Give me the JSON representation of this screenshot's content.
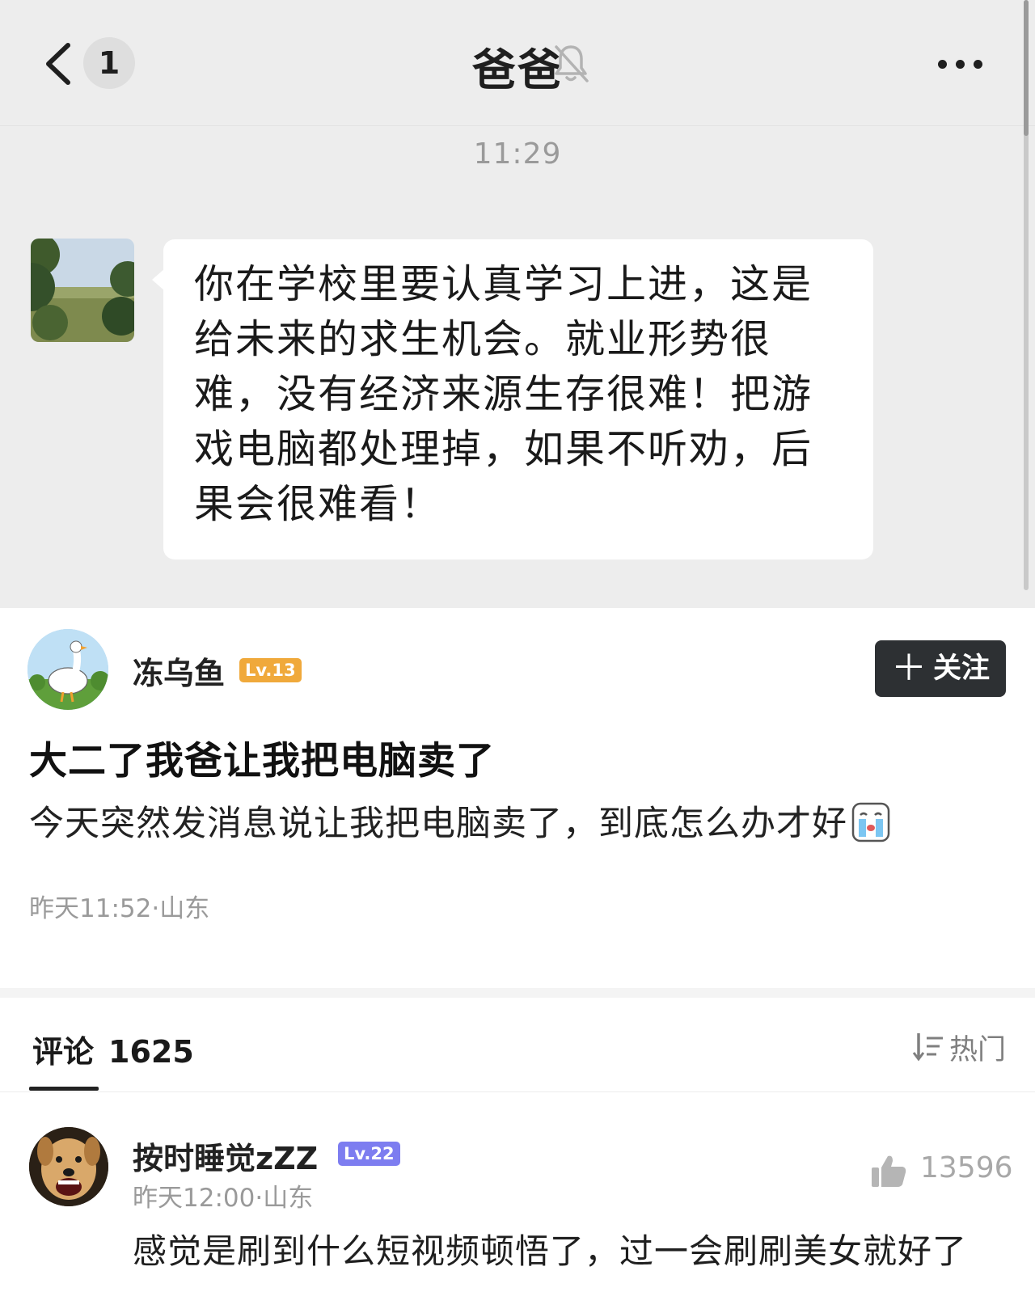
{
  "chat": {
    "unread_count": "1",
    "title": "爸爸",
    "timestamp": "11:29",
    "message": "你在学校里要认真学习上进，这是给未来的求生机会。就业形势很难，没有经济来源生存很难！把游戏电脑都处理掉，如果不听劝，后果会很难看！"
  },
  "post": {
    "author": "冻乌鱼",
    "author_level": "Lv.13",
    "follow_label": "关注",
    "title": "大二了我爸让我把电脑卖了",
    "body": "今天突然发消息说让我把电脑卖了，到底怎么办才好",
    "meta": "昨天11:52·山东"
  },
  "comments": {
    "tab_label": "评论",
    "count": "1625",
    "sort_label": "热门",
    "items": [
      {
        "name": "按时睡觉zZZ",
        "level": "Lv.22",
        "meta": "昨天12:00·山东",
        "likes": "13596",
        "text": "感觉是刷到什么短视频顿悟了，过一会刷刷美女就好了"
      }
    ]
  },
  "icons": {
    "back": "chevron-left-icon",
    "mute": "bell-off-icon",
    "more": "more-dots-icon",
    "follow": "plus-icon",
    "sort": "sort-icon",
    "like": "thumbs-up-icon",
    "emoji": "crying-emoji-icon"
  },
  "colors": {
    "chat_bg": "#ededed",
    "follow_bg": "#2d3033",
    "level_orange": "#f0a93b",
    "level_purple": "#7d7df0",
    "meta_gray": "#9a9a9a"
  }
}
